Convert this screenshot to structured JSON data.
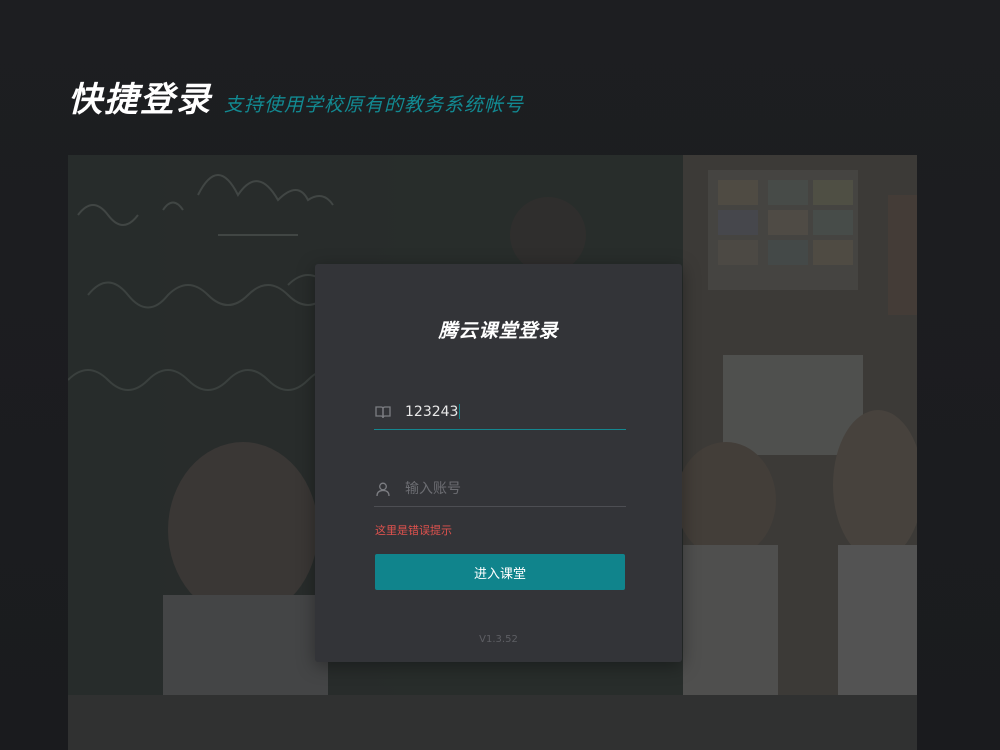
{
  "header": {
    "title": "快捷登录",
    "subtitle": "支持使用学校原有的教务系统帐号"
  },
  "login": {
    "title": "腾云课堂登录",
    "school_field": {
      "value": "123243",
      "icon": "book-icon"
    },
    "account_field": {
      "placeholder": "输入账号",
      "value": "",
      "icon": "user-icon"
    },
    "error_message": "这里是错误提示",
    "submit_label": "进入课堂",
    "version": "V1.3.52"
  },
  "colors": {
    "accent": "#10848c",
    "error": "#e0524e",
    "card": "#333438",
    "background": "#1c1d20"
  }
}
